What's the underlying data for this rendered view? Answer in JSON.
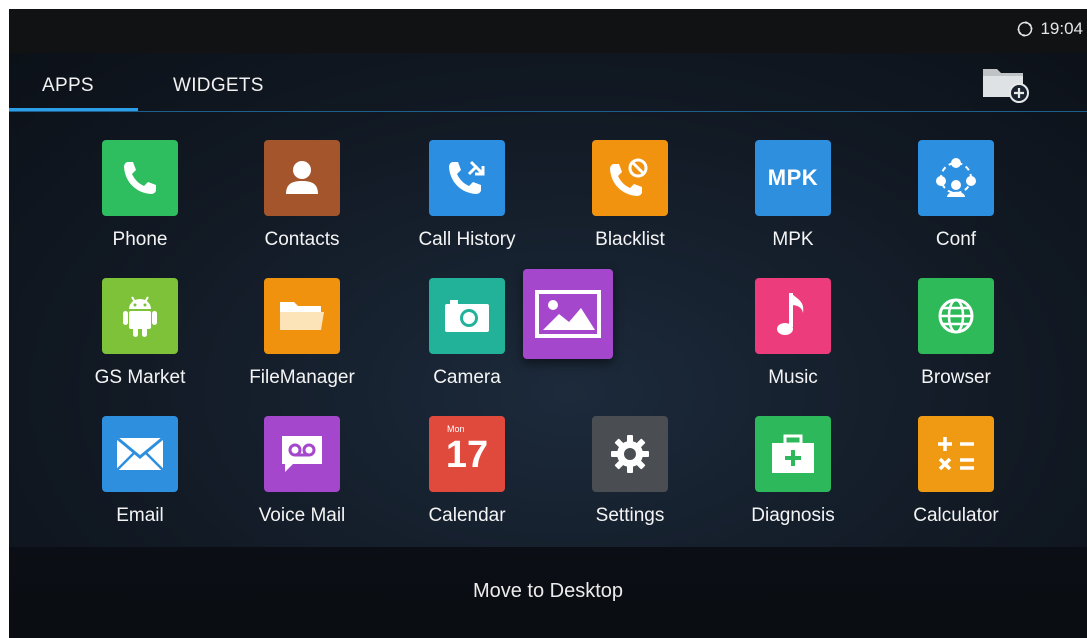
{
  "status_bar": {
    "time": "19:04",
    "sync_icon": "sync-icon"
  },
  "tabs": [
    {
      "label": "APPS",
      "active": true
    },
    {
      "label": "WIDGETS",
      "active": false
    }
  ],
  "header": {
    "new_folder_icon": "folder-add-icon"
  },
  "apps": [
    {
      "label": "Phone",
      "icon": "phone-icon",
      "color": "#2ebd5f"
    },
    {
      "label": "Contacts",
      "icon": "contact-icon",
      "color": "#a4552b"
    },
    {
      "label": "Call History",
      "icon": "call-history-icon",
      "color": "#2b8ee0"
    },
    {
      "label": "Blacklist",
      "icon": "blacklist-icon",
      "color": "#f2930f"
    },
    {
      "label": "MPK",
      "icon": "mpk-icon",
      "icon_text": "MPK",
      "color": "#2e8fdf"
    },
    {
      "label": "Conf",
      "icon": "conference-icon",
      "color": "#2c8fdf"
    },
    {
      "label": "GS Market",
      "icon": "android-icon",
      "color": "#7ec23a"
    },
    {
      "label": "FileManager",
      "icon": "folder-icon",
      "color": "#f0920e"
    },
    {
      "label": "Camera",
      "icon": "camera-icon",
      "color": "#22b29a"
    },
    {
      "label": "Music",
      "icon": "music-note-icon",
      "color": "#ec3c7c"
    },
    {
      "label": "Browser",
      "icon": "globe-icon",
      "color": "#2fba5a"
    },
    {
      "label": "Email",
      "icon": "envelope-icon",
      "color": "#2f8fdf"
    },
    {
      "label": "Voice Mail",
      "icon": "voicemail-icon",
      "color": "#a547cc"
    },
    {
      "label": "Calendar",
      "icon": "calendar-icon",
      "icon_text": "17",
      "icon_subtext": "Mon",
      "color": "#e04a3c"
    },
    {
      "label": "Settings",
      "icon": "gear-icon",
      "color": "#4a4e52"
    },
    {
      "label": "Diagnosis",
      "icon": "first-aid-kit-icon",
      "color": "#2db85c"
    },
    {
      "label": "Calculator",
      "icon": "calculator-icon",
      "color": "#f09a14"
    }
  ],
  "dragged_app": {
    "icon": "gallery-icon",
    "color": "#a547cc"
  },
  "drop_target": {
    "label": "Move to Desktop"
  }
}
